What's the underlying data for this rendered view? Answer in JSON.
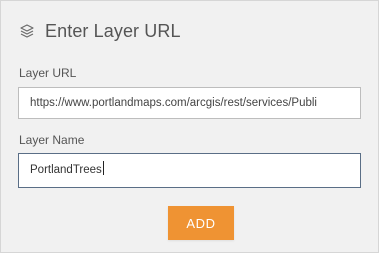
{
  "panel": {
    "title": "Enter Layer URL",
    "title_icon": "layers-icon"
  },
  "fields": {
    "url": {
      "label": "Layer URL",
      "value": "https://www.portlandmaps.com/arcgis/rest/services/Publi"
    },
    "name": {
      "label": "Layer Name",
      "value": "PortlandTrees"
    }
  },
  "actions": {
    "add_label": "ADD"
  },
  "colors": {
    "panel_background": "#f1f1f1",
    "accent": "#ef9333",
    "focus_border": "#5a6e86"
  }
}
